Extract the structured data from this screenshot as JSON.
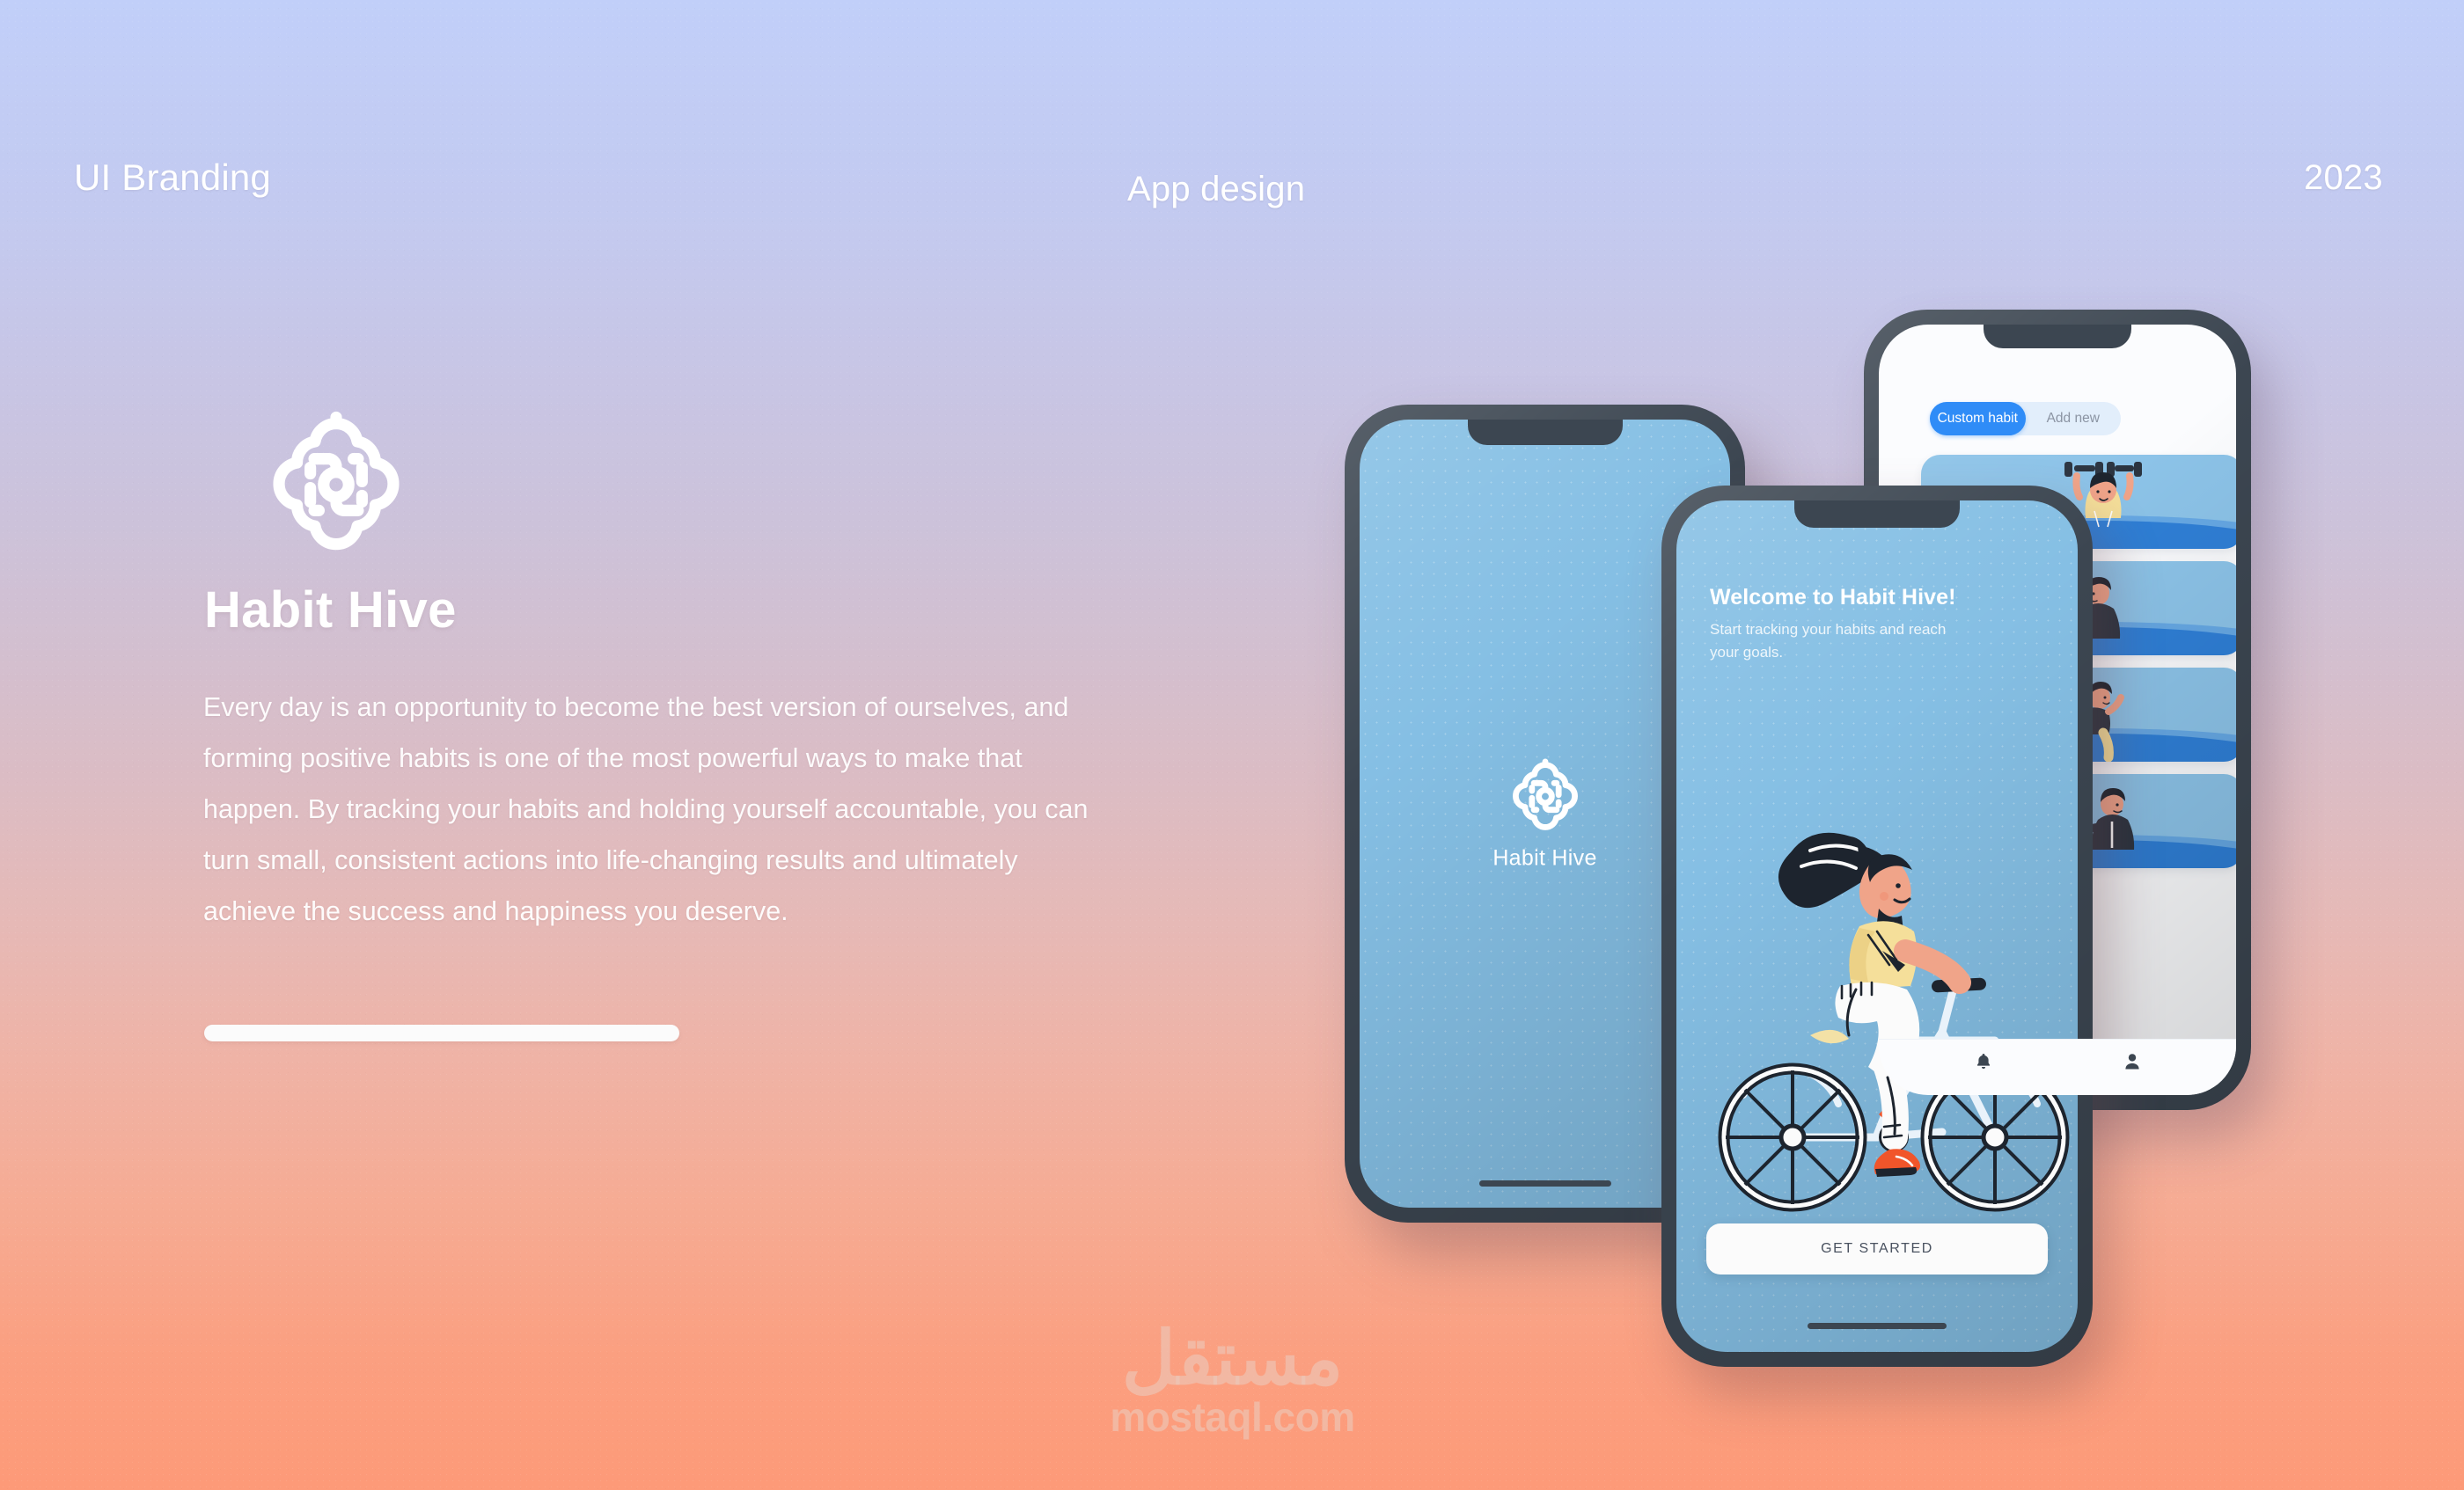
{
  "header": {
    "left_label": "UI Branding",
    "center_label": "App design",
    "year": "2023"
  },
  "brand": {
    "logo_icon": "habit-hive-flower-logo",
    "title": "Habit Hive",
    "body": "Every day is an opportunity to become the best version of ourselves, and forming positive habits is one of the most powerful ways to make that happen. By tracking your habits and holding yourself accountable, you can turn small, consistent actions into life-changing results and ultimately achieve the success and happiness you deserve."
  },
  "watermark": {
    "arabic": "مستقل",
    "latin": "mostaql.com"
  },
  "phones": {
    "splash": {
      "logo_icon": "habit-hive-flower-logo",
      "app_name": "Habit Hive"
    },
    "welcome": {
      "title": "Welcome to Habit Hive!",
      "subtitle": "Start tracking your habits and reach your goals.",
      "illustration": "woman-riding-bicycle-illustration",
      "cta_label": "GET STARTED"
    },
    "habits": {
      "segments": [
        {
          "label": "Custom habit",
          "active": true
        },
        {
          "label": "Add new",
          "active": false
        }
      ],
      "cards": [
        {
          "illustration": "woman-lifting-dumbbells-illustration"
        },
        {
          "illustration": "man-writing-at-desk-illustration"
        },
        {
          "illustration": "woman-running-illustration"
        },
        {
          "illustration": "man-holding-coin-illustration"
        }
      ],
      "bottom_nav": [
        {
          "icon": "bell-icon"
        },
        {
          "icon": "person-icon"
        }
      ]
    }
  },
  "colors": {
    "gradient_top": "#c1cff9",
    "gradient_bottom": "#fd9a78",
    "phone_bezel": "#3c4651",
    "screen_blue": "#85bfe4",
    "accent_blue": "#2f8cf7",
    "card_blue": "#8cc3e8",
    "wave_blue": "#2f7fd6",
    "cta_bg": "#fbfbfb"
  }
}
